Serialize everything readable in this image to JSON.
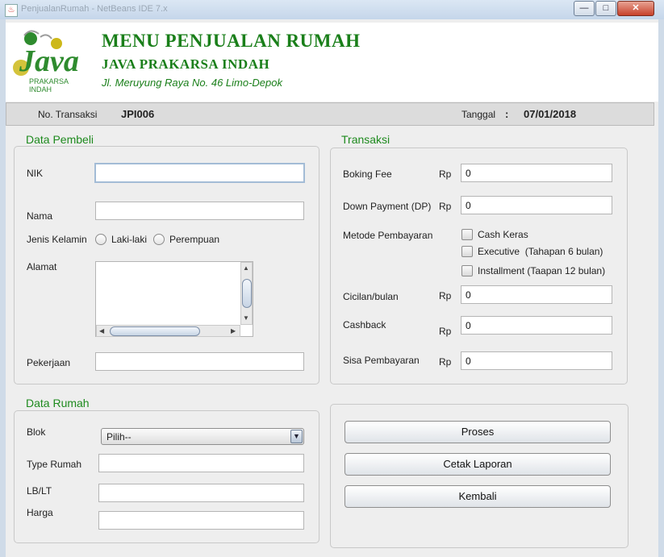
{
  "window": {
    "title": "PenjualanRumah - NetBeans IDE 7.x",
    "min_glyph": "—",
    "max_glyph": "□",
    "close_glyph": "✕"
  },
  "header": {
    "logo": {
      "word": "Java",
      "line1": "PRAKARSA",
      "line2": "INDAH"
    },
    "title": "MENU PENJUALAN RUMAH",
    "company": "JAVA PRAKARSA INDAH",
    "address": "Jl. Meruyung Raya No. 46 Limo-Depok"
  },
  "transaction_bar": {
    "no_label": "No. Transaksi",
    "no_value": "JPI006",
    "date_label": "Tanggal",
    "date_sep": ":",
    "date_value": "07/01/2018"
  },
  "buyer": {
    "title": "Data Pembeli",
    "nik_label": "NIK",
    "nik_value": "",
    "nama_label": "Nama",
    "nama_value": "",
    "gender_label": "Jenis Kelamin",
    "gender_options": [
      "Laki-laki",
      "Perempuan"
    ],
    "alamat_label": "Alamat",
    "alamat_value": "",
    "pekerjaan_label": "Pekerjaan",
    "pekerjaan_value": ""
  },
  "house": {
    "title": "Data Rumah",
    "blok_label": "Blok",
    "blok_selected": "Pilih--",
    "type_label": "Type Rumah",
    "type_value": "",
    "lblt_label": "LB/LT",
    "lblt_value": "",
    "harga_label": "Harga",
    "harga_value": ""
  },
  "transaction": {
    "title": "Transaksi",
    "currency": "Rp",
    "booking_label": "Boking Fee",
    "booking_value": "0",
    "dp_label": "Down Payment (DP)",
    "dp_value": "0",
    "method_label": "Metode Pembayaran",
    "methods": [
      "Cash Keras",
      "Executive  (Tahapan 6 bulan)",
      "Installment (Taapan 12 bulan)"
    ],
    "cicilan_label": "Cicilan/bulan",
    "cicilan_value": "0",
    "cashback_label": "Cashback",
    "cashback_value": "0",
    "sisa_label": "Sisa Pembayaran",
    "sisa_value": "0"
  },
  "actions": {
    "proses": "Proses",
    "cetak": "Cetak Laporan",
    "kembali": "Kembali"
  },
  "colors": {
    "accent_green": "#1a7f1a",
    "title_green": "#1e8a1e",
    "logo_yellow": "#c9b21a"
  }
}
